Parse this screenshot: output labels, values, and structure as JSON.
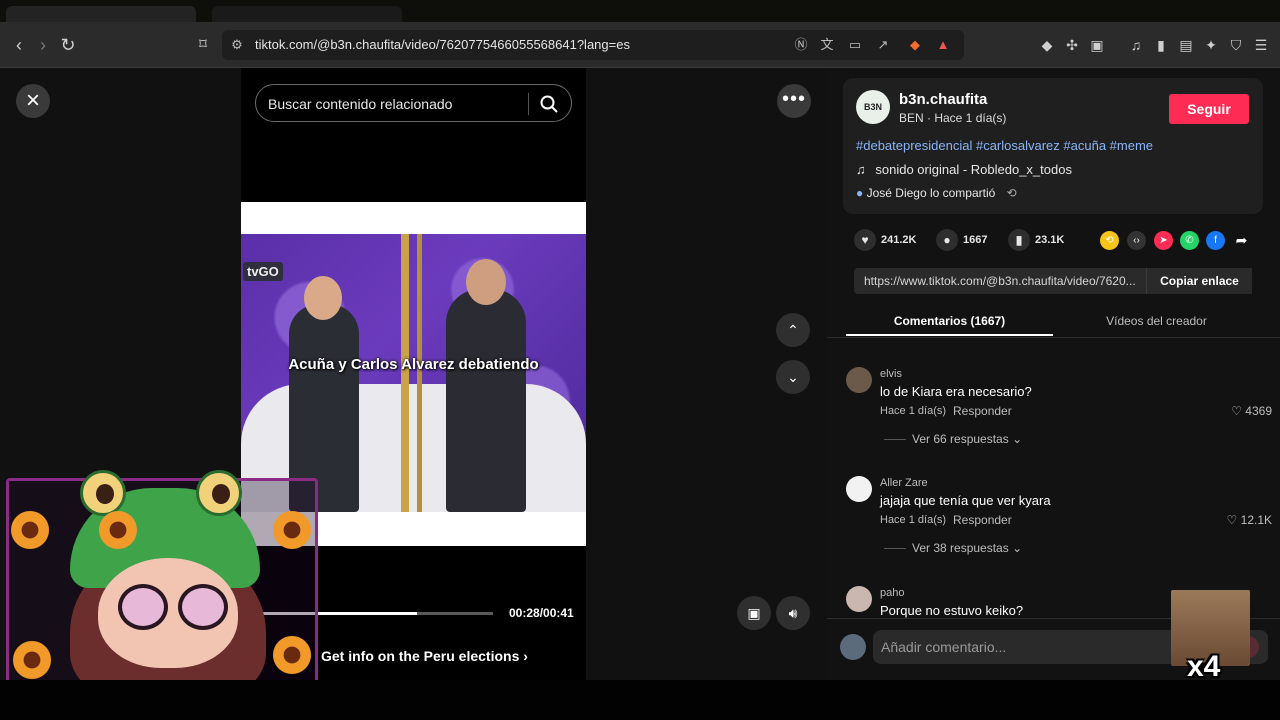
{
  "browser": {
    "url": "tiktok.com/@b3n.chaufita/video/7620775466055568641?lang=es"
  },
  "player": {
    "search_placeholder": "Buscar contenido relacionado",
    "channel_logo": "tvGO",
    "caption": "Acuña y Carlos Alvarez debatiendo",
    "time": "00:28/00:41",
    "progress": 0.68,
    "elections_banner": "Get info on the Peru elections"
  },
  "creator": {
    "avatar_text": "B3N",
    "username": "b3n.chaufita",
    "meta": "BEN · Hace 1 día(s)",
    "follow_label": "Seguir",
    "hashtags": "#debatepresidencial #carlosalvarez #acuña #meme",
    "sound": "sonido original - Robledo_x_todos",
    "shared_by": "José Diego lo compartió"
  },
  "stats": {
    "likes": "241.2K",
    "comments": "1667",
    "saves": "23.1K"
  },
  "share": {
    "link": "https://www.tiktok.com/@b3n.chaufita/video/7620...",
    "copy_label": "Copiar enlace"
  },
  "tabs": {
    "comments": "Comentarios (1667)",
    "creator_videos": "Vídeos del creador"
  },
  "comments": [
    {
      "user": "elvis",
      "text": "lo de Kiara era necesario?",
      "time": "Hace 1 día(s)",
      "reply": "Responder",
      "likes": "4369",
      "more": "Ver 66 respuestas"
    },
    {
      "user": "Aller Zare",
      "text": "jajaja que tenía que ver kyara",
      "time": "Hace 1 día(s)",
      "reply": "Responder",
      "likes": "12.1K",
      "more": "Ver 38 respuestas"
    },
    {
      "user": "paho",
      "text": "Porque no estuvo keiko?"
    }
  ],
  "composer": {
    "placeholder": "Añadir comentario..."
  },
  "sticker": {
    "text": "x4"
  },
  "colors": {
    "follow": "#fe2c55",
    "hashtag": "#8ab4f8"
  }
}
